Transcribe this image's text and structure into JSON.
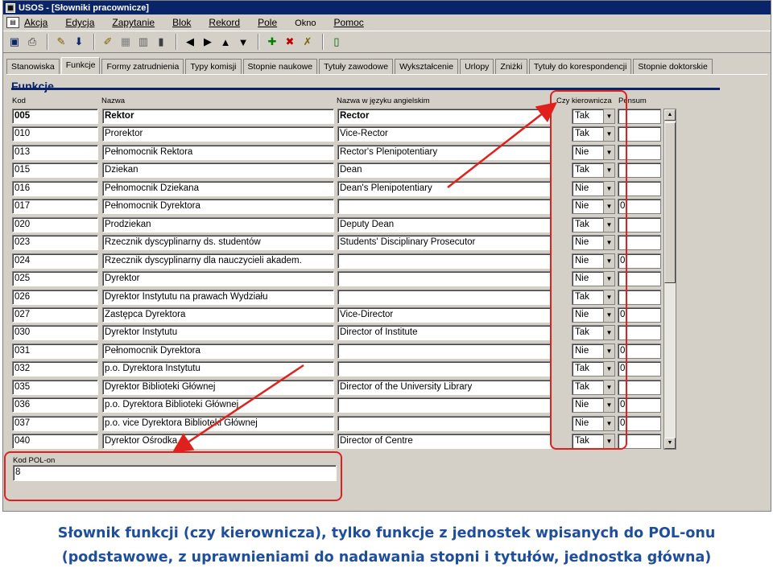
{
  "window": {
    "title": "USOS - [Słowniki pracownicze]",
    "icon": "app-icon"
  },
  "menu": [
    "Akcja",
    "Edycja",
    "Zapytanie",
    "Blok",
    "Rekord",
    "Pole",
    "Okno",
    "Pomoc"
  ],
  "toolbar": [
    "save-icon",
    "print-icon",
    "edit-icon",
    "download-icon",
    "query-enter-icon",
    "query-execute-icon",
    "count-icon",
    "chart-icon",
    "prev-block-icon",
    "prev-record-icon",
    "next-record-icon",
    "next-block-icon",
    "insert-record-icon",
    "delete-record-icon",
    "clear-icon",
    "exit-icon"
  ],
  "tabs": [
    "Stanowiska",
    "Funkcje",
    "Formy zatrudnienia",
    "Typy komisji",
    "Stopnie naukowe",
    "Tytuły zawodowe",
    "Wykształcenie",
    "Urlopy",
    "Zniżki",
    "Tytuły do korespondencji",
    "Stopnie doktorskie"
  ],
  "active_tab": "Funkcje",
  "section_title": "Funkcje",
  "columns": {
    "kod": "Kod",
    "nazwa": "Nazwa",
    "nazwa_en": "Nazwa w języku angielskim",
    "kier": "Czy kierownicza",
    "pensum": "Pensum"
  },
  "rows": [
    {
      "kod": "005",
      "nazwa": "Rektor",
      "nazwa_en": "Rector",
      "kier": "Tak",
      "pensum": ""
    },
    {
      "kod": "010",
      "nazwa": "Prorektor",
      "nazwa_en": "Vice-Rector",
      "kier": "Tak",
      "pensum": ""
    },
    {
      "kod": "013",
      "nazwa": "Pełnomocnik Rektora",
      "nazwa_en": "Rector's Plenipotentiary",
      "kier": "Nie",
      "pensum": ""
    },
    {
      "kod": "015",
      "nazwa": "Dziekan",
      "nazwa_en": "Dean",
      "kier": "Tak",
      "pensum": ""
    },
    {
      "kod": "016",
      "nazwa": "Pełnomocnik Dziekana",
      "nazwa_en": "Dean's Plenipotentiary",
      "kier": "Nie",
      "pensum": ""
    },
    {
      "kod": "017",
      "nazwa": "Pełnomocnik Dyrektora",
      "nazwa_en": "",
      "kier": "Nie",
      "pensum": "0"
    },
    {
      "kod": "020",
      "nazwa": "Prodziekan",
      "nazwa_en": "Deputy Dean",
      "kier": "Tak",
      "pensum": ""
    },
    {
      "kod": "023",
      "nazwa": "Rzecznik dyscyplinarny ds. studentów",
      "nazwa_en": "Students' Disciplinary Prosecutor",
      "kier": "Nie",
      "pensum": ""
    },
    {
      "kod": "024",
      "nazwa": "Rzecznik dyscyplinarny dla nauczycieli akadem.",
      "nazwa_en": "",
      "kier": "Nie",
      "pensum": "0"
    },
    {
      "kod": "025",
      "nazwa": "Dyrektor",
      "nazwa_en": "",
      "kier": "Nie",
      "pensum": ""
    },
    {
      "kod": "026",
      "nazwa": "Dyrektor Instytutu na prawach Wydziału",
      "nazwa_en": "",
      "kier": "Tak",
      "pensum": ""
    },
    {
      "kod": "027",
      "nazwa": "Zastępca Dyrektora",
      "nazwa_en": "Vice-Director",
      "kier": "Nie",
      "pensum": "0"
    },
    {
      "kod": "030",
      "nazwa": "Dyrektor Instytutu",
      "nazwa_en": "Director of Institute",
      "kier": "Tak",
      "pensum": ""
    },
    {
      "kod": "031",
      "nazwa": "Pełnomocnik Dyrektora",
      "nazwa_en": "",
      "kier": "Nie",
      "pensum": "0"
    },
    {
      "kod": "032",
      "nazwa": "p.o. Dyrektora Instytutu",
      "nazwa_en": "",
      "kier": "Tak",
      "pensum": "0"
    },
    {
      "kod": "035",
      "nazwa": "Dyrektor Biblioteki Głównej",
      "nazwa_en": "Director of the University Library",
      "kier": "Tak",
      "pensum": ""
    },
    {
      "kod": "036",
      "nazwa": "p.o. Dyrektora Biblioteki Głównej",
      "nazwa_en": "",
      "kier": "Nie",
      "pensum": "0"
    },
    {
      "kod": "037",
      "nazwa": "p.o. vice Dyrektora Biblioteki Głównej",
      "nazwa_en": "",
      "kier": "Nie",
      "pensum": "0"
    },
    {
      "kod": "040",
      "nazwa": "Dyrektor Ośrodka",
      "nazwa_en": "Director of Centre",
      "kier": "Tak",
      "pensum": ""
    }
  ],
  "pol": {
    "label": "Kod POL-on",
    "value": "8"
  },
  "caption": {
    "line1": "Słownik funkcji (czy kierownicza), tylko funkcje z jednostek wpisanych do POL-onu",
    "line2": "(podstawowe, z uprawnieniami do nadawania stopni i tytułów, jednostka główna)"
  },
  "colors": {
    "annotation": "#e0201c",
    "caption": "#1f4e9a",
    "section": "#0a246a"
  }
}
